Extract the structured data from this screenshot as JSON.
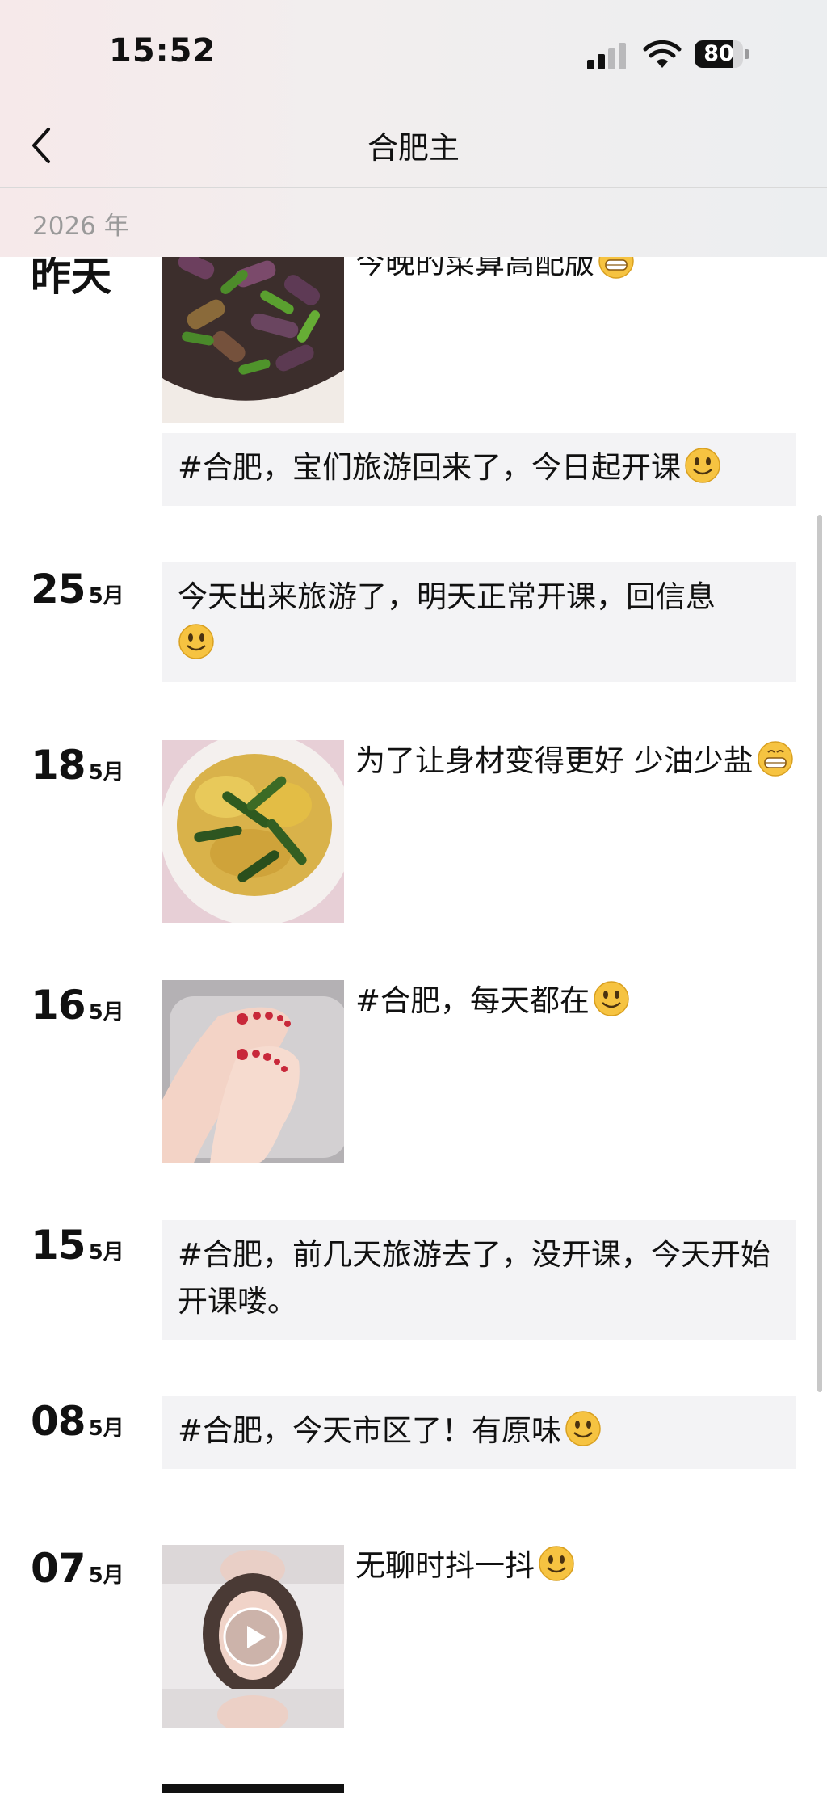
{
  "status_bar": {
    "time": "15:52",
    "battery": "80",
    "battery_level": 0.8
  },
  "nav": {
    "title": "合肥主"
  },
  "year_label": "2026 年",
  "posts": [
    {
      "date": "昨天",
      "text": "今晚的菜算高配版",
      "image": "eggplant-dish"
    },
    {
      "text": "#合肥，宝们旅游回来了，今日起开课"
    },
    {
      "day": "25",
      "month": "5月",
      "text": "今天出来旅游了，明天正常开课，回信息"
    },
    {
      "day": "18",
      "month": "5月",
      "text": "为了让身材变得更好 少油少盐",
      "image": "egg-vegetable-dish"
    },
    {
      "day": "16",
      "month": "5月",
      "text": "#合肥，每天都在",
      "image": "feet-photo"
    },
    {
      "day": "15",
      "month": "5月",
      "text": "#合肥，前几天旅游去了，没开课，今天开始开课喽。"
    },
    {
      "day": "08",
      "month": "5月",
      "text": "#合肥，今天市区了！有原味"
    },
    {
      "day": "07",
      "month": "5月",
      "text": "无聊时抖一抖",
      "image": "video-thumbnail"
    }
  ],
  "icons": [
    "back-arrow-icon",
    "signal-icon",
    "wifi-icon",
    "battery-icon",
    "smile-emoji",
    "grin-emoji",
    "play-icon"
  ],
  "colors": {
    "card_bg": "#f3f3f5",
    "year_text": "#9a9a9a",
    "header_bg": "#f0eeef"
  }
}
